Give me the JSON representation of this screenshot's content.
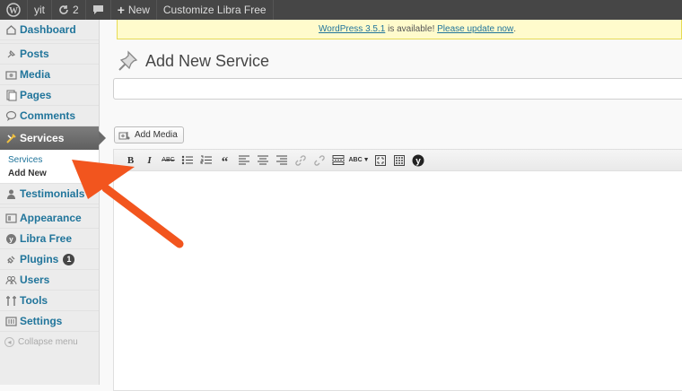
{
  "admin_bar": {
    "site_name": "yit",
    "updates_count": "2",
    "new_label": "New",
    "customize_label": "Customize Libra Free"
  },
  "sidebar": {
    "items": [
      {
        "label": "Dashboard",
        "icon": "dashboard-icon"
      },
      {
        "label": "Posts",
        "icon": "pin-icon"
      },
      {
        "label": "Media",
        "icon": "media-icon"
      },
      {
        "label": "Pages",
        "icon": "pages-icon"
      },
      {
        "label": "Comments",
        "icon": "comment-icon"
      },
      {
        "label": "Services",
        "icon": "services-icon"
      },
      {
        "label": "Testimonials",
        "icon": "person-icon"
      },
      {
        "label": "Appearance",
        "icon": "appearance-icon"
      },
      {
        "label": "Libra Free",
        "icon": "theme-icon"
      },
      {
        "label": "Plugins",
        "icon": "plug-icon",
        "badge": "1"
      },
      {
        "label": "Users",
        "icon": "users-icon"
      },
      {
        "label": "Tools",
        "icon": "tools-icon"
      },
      {
        "label": "Settings",
        "icon": "settings-icon"
      }
    ],
    "submenu": {
      "services": "Services",
      "add_new": "Add New"
    },
    "collapse_label": "Collapse menu"
  },
  "notice": {
    "link_text": "WordPress 3.5.1",
    "middle_text": " is available! ",
    "update_link": "Please update now",
    "end_text": "."
  },
  "page": {
    "title": "Add New Service",
    "title_placeholder": "",
    "add_media_label": "Add Media"
  },
  "toolbar": {
    "buttons": [
      "bold",
      "italic",
      "strikethrough",
      "bullet-list",
      "numbered-list",
      "blockquote",
      "align-left",
      "align-center",
      "align-right",
      "link",
      "unlink",
      "more",
      "spellcheck",
      "fullscreen",
      "kitchen-sink",
      "custom"
    ]
  },
  "colors": {
    "link": "#21759b",
    "admin_bar": "#464646",
    "active_menu": "#6b6b6b",
    "notice_bg": "#fffbcc",
    "arrow": "#f2551e"
  }
}
